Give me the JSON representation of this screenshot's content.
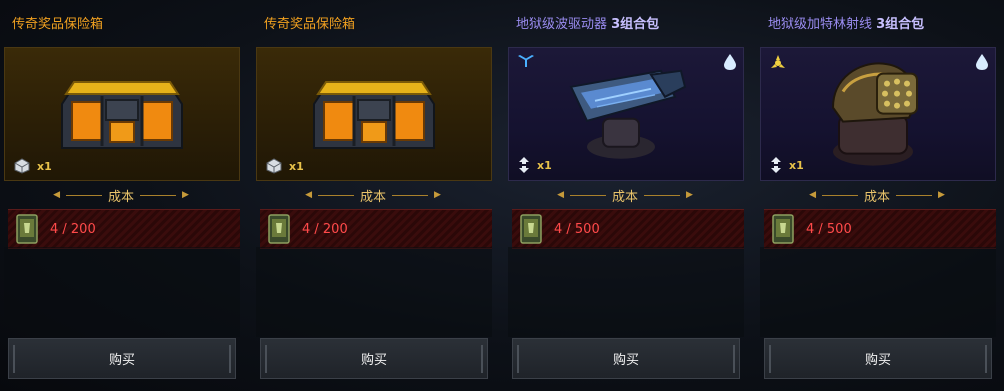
{
  "colors": {
    "legendary_title": "#f0a020",
    "hell_title": "#9a8cf0",
    "cost_red": "#ff4a4a",
    "qty_gold": "#e8c24a"
  },
  "items": [
    {
      "title": "传奇奖品保险箱",
      "title_suffix": "",
      "qty": "x1",
      "cost_label": "成本",
      "cost_amount": "4 / 200",
      "buy_label": "购买",
      "kind": "chest"
    },
    {
      "title": "传奇奖品保险箱",
      "title_suffix": "",
      "qty": "x1",
      "cost_label": "成本",
      "cost_amount": "4 / 200",
      "buy_label": "购买",
      "kind": "chest"
    },
    {
      "title": "地狱级波驱动器 ",
      "title_suffix": "3组合包",
      "qty": "x1",
      "cost_label": "成本",
      "cost_amount": "4 / 500",
      "buy_label": "购买",
      "kind": "weapon-blue"
    },
    {
      "title": "地狱级加特林射线 ",
      "title_suffix": "3组合包",
      "qty": "x1",
      "cost_label": "成本",
      "cost_amount": "4 / 500",
      "buy_label": "购买",
      "kind": "weapon-gold"
    }
  ]
}
